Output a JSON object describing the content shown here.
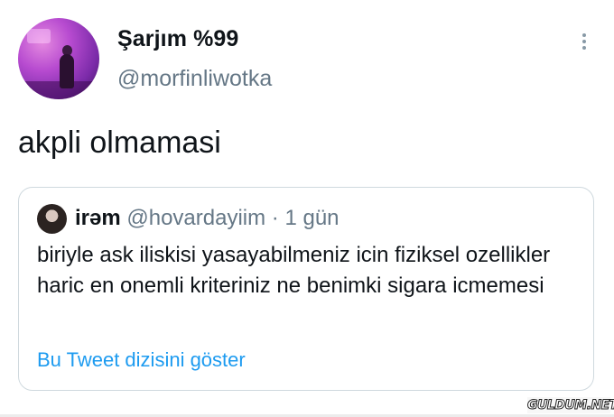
{
  "author": {
    "display_name": "Şarjım %99",
    "handle": "@morfinliwotka"
  },
  "tweet": {
    "text": "akpli olmamasi"
  },
  "quoted_tweet": {
    "display_name": "irəm",
    "handle": "@hovardayiim",
    "separator": "·",
    "time": "1 gün",
    "text": "biriyle ask iliskisi yasayabilmeniz icin fiziksel ozellikler haric en onemli kriteriniz ne benimki sigara icmemesi",
    "show_thread_label": "Bu Tweet dizisini göster"
  },
  "icons": {
    "more": "more-vertical-icon"
  },
  "colors": {
    "link_blue": "#1d9bf0",
    "secondary_text": "#657786",
    "border": "#cfd9de"
  },
  "watermark": "GULDUM.NET"
}
